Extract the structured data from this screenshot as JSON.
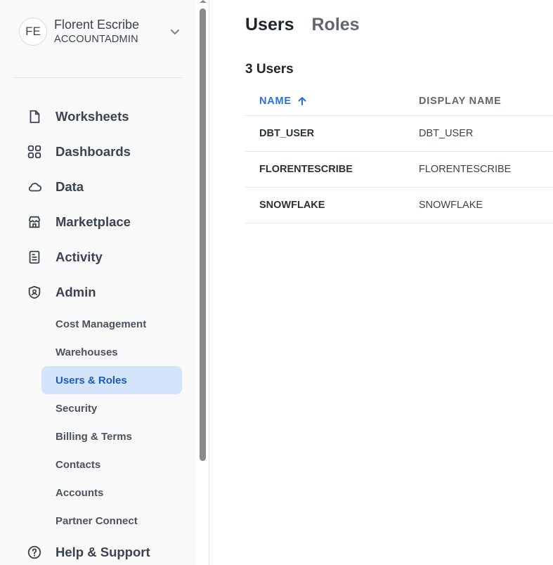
{
  "user": {
    "initials": "FE",
    "name": "Florent Escribe",
    "role": "ACCOUNTADMIN"
  },
  "nav": {
    "items": [
      {
        "label": "Worksheets",
        "icon": "document-icon"
      },
      {
        "label": "Dashboards",
        "icon": "grid-icon"
      },
      {
        "label": "Data",
        "icon": "cloud-icon"
      },
      {
        "label": "Marketplace",
        "icon": "storefront-icon"
      },
      {
        "label": "Activity",
        "icon": "activity-log-icon"
      },
      {
        "label": "Admin",
        "icon": "shield-user-icon"
      }
    ],
    "admin_subitems": [
      {
        "label": "Cost Management"
      },
      {
        "label": "Warehouses"
      },
      {
        "label": "Users & Roles",
        "active": true
      },
      {
        "label": "Security"
      },
      {
        "label": "Billing & Terms"
      },
      {
        "label": "Contacts"
      },
      {
        "label": "Accounts"
      },
      {
        "label": "Partner Connect"
      }
    ],
    "help": {
      "label": "Help & Support",
      "icon": "help-circle-icon"
    }
  },
  "main": {
    "tabs": [
      {
        "label": "Users",
        "active": true
      },
      {
        "label": "Roles",
        "active": false
      }
    ],
    "count_label": "3 Users",
    "table": {
      "columns": [
        {
          "label": "NAME",
          "sorted": "ascending"
        },
        {
          "label": "DISPLAY NAME"
        }
      ],
      "rows": [
        {
          "name": "DBT_USER",
          "display_name": "DBT_USER"
        },
        {
          "name": "FLORENTESCRIBE",
          "display_name": "FLORENTESCRIBE"
        },
        {
          "name": "SNOWFLAKE",
          "display_name": "SNOWFLAKE"
        }
      ]
    }
  },
  "colors": {
    "accent": "#2b6fd6",
    "active_bg": "#d4e5fb",
    "sidebar_bg": "#f9f9fa",
    "text_dark": "#1e252d"
  }
}
